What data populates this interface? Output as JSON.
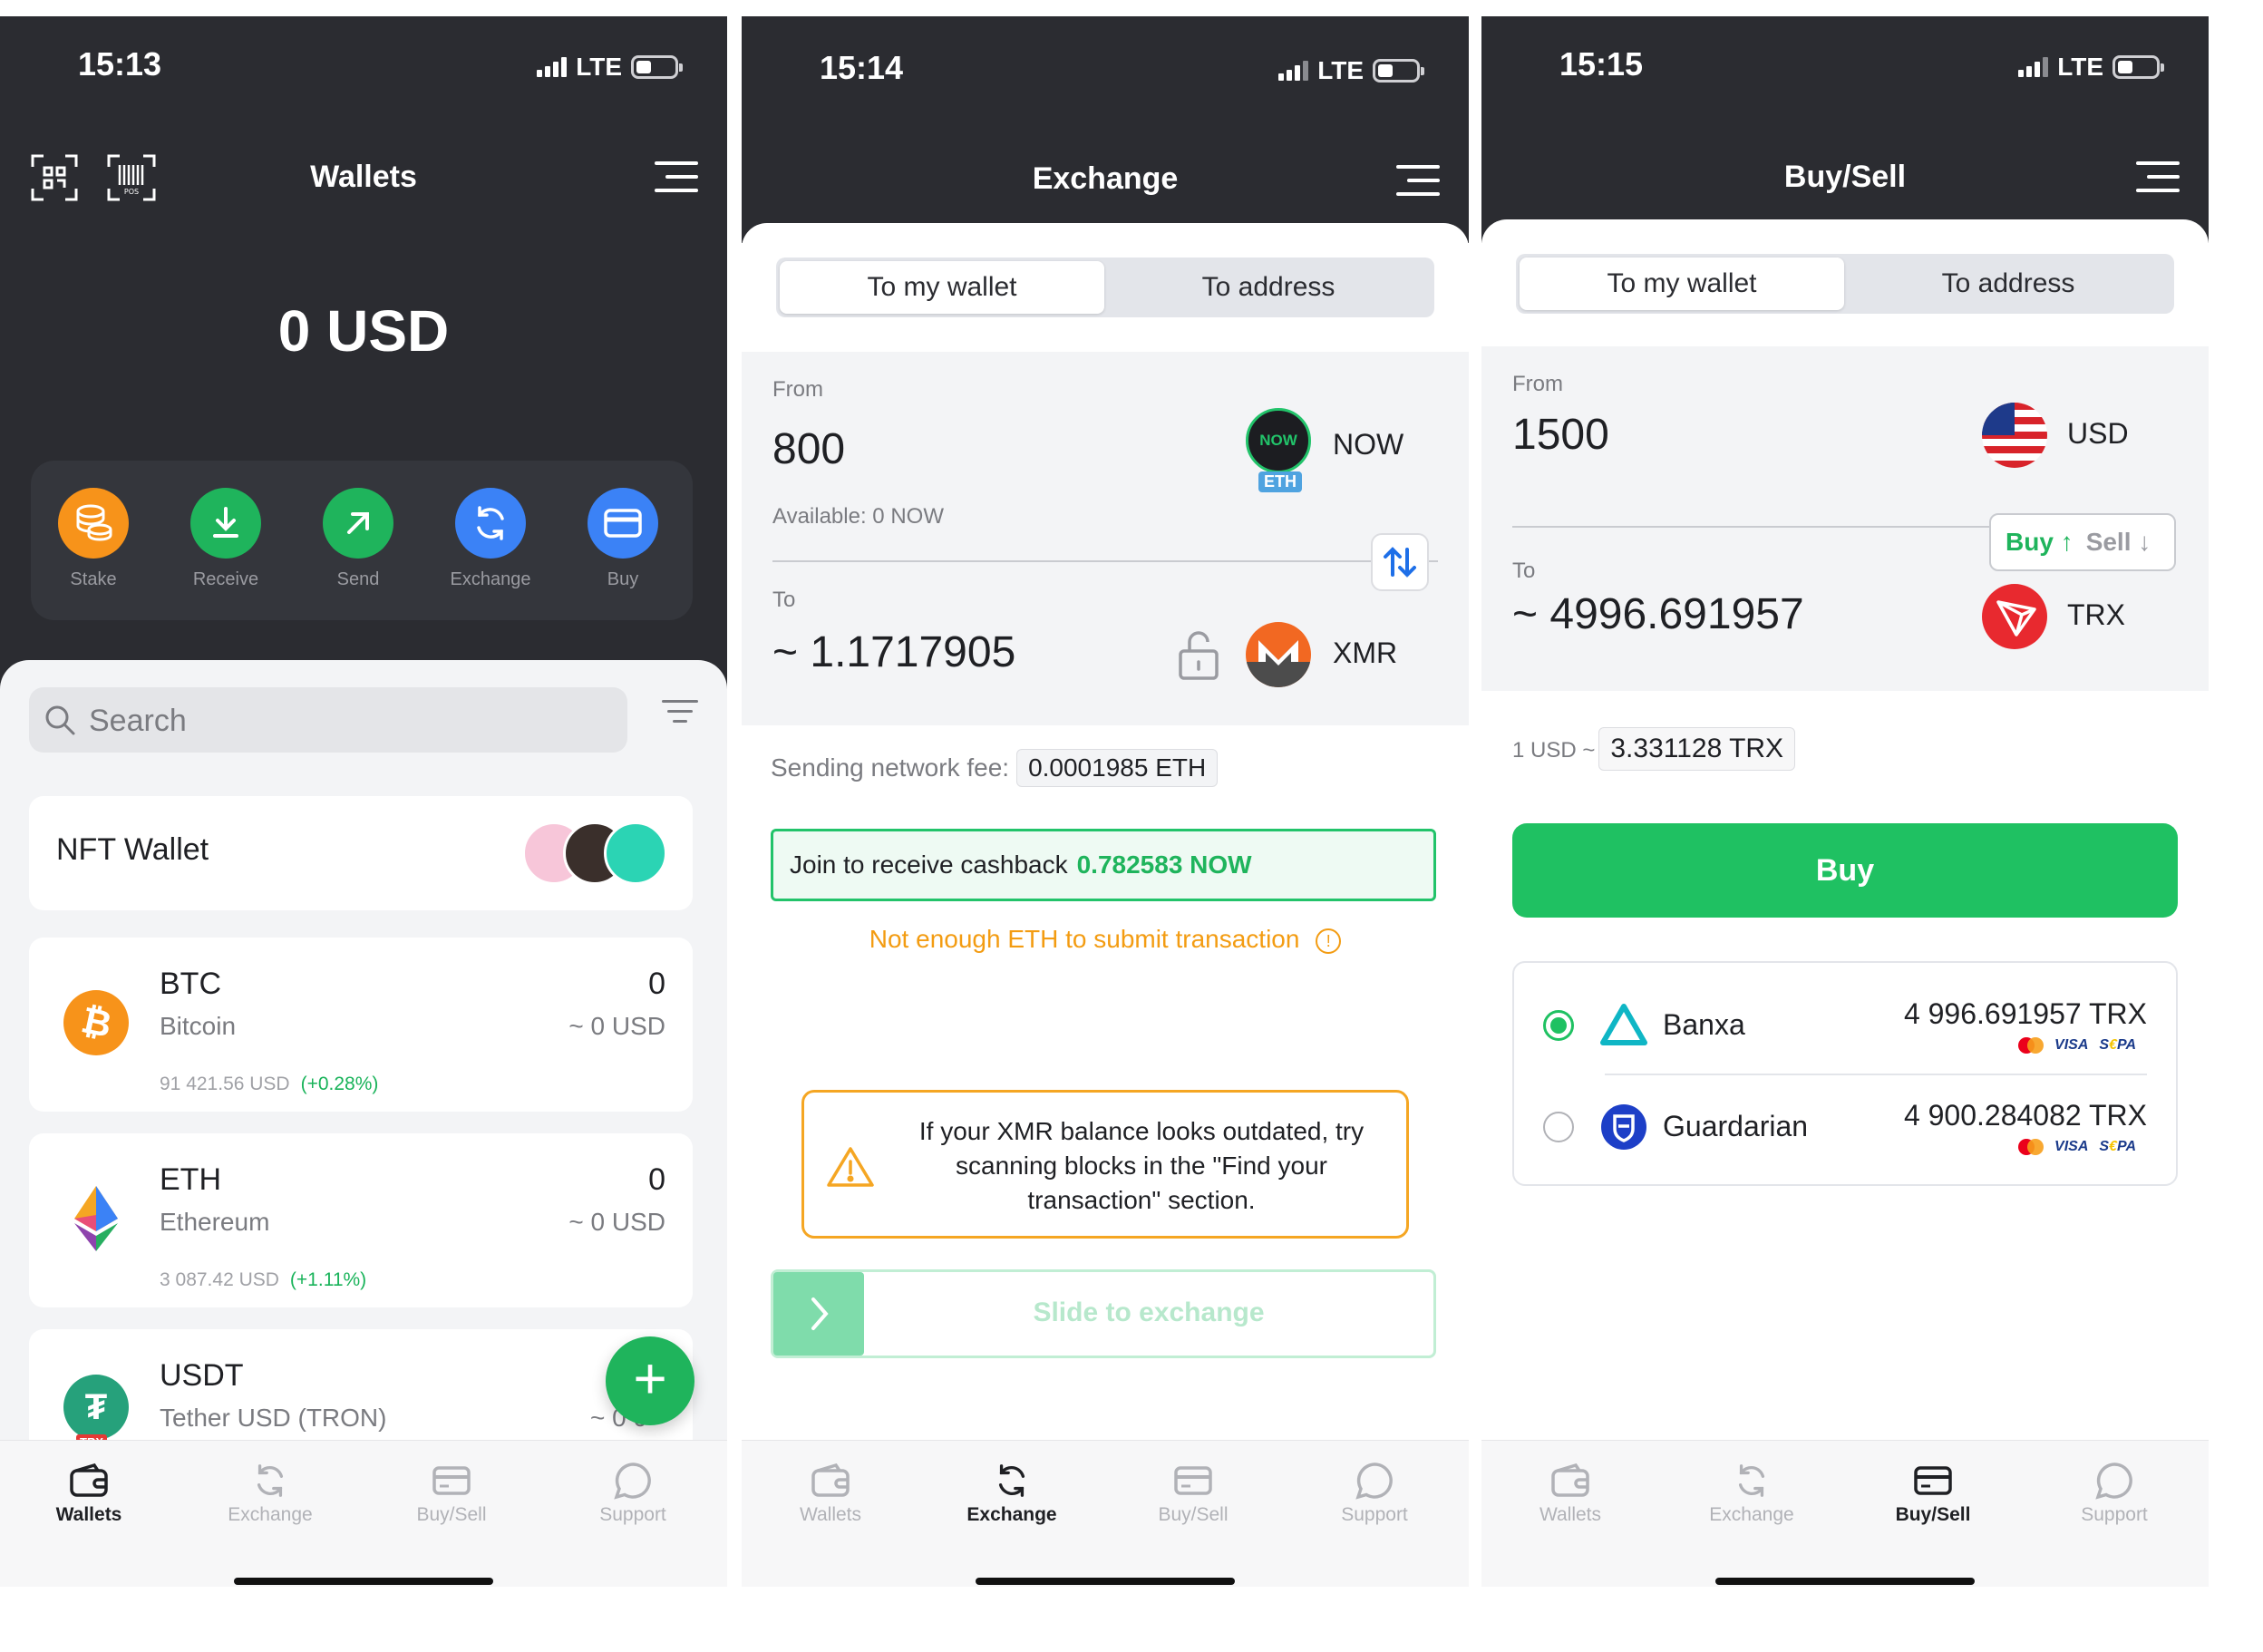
{
  "colors": {
    "dark": "#2b2c31",
    "green": "#1fc162",
    "orange": "#f39c12",
    "blue": "#3b82f6"
  },
  "screen1": {
    "time": "15:13",
    "network": "LTE",
    "title": "Wallets",
    "balance": "0 USD",
    "actions": [
      {
        "label": "Stake",
        "icon": "coins-icon",
        "color": "#f7931a"
      },
      {
        "label": "Receive",
        "icon": "download-icon",
        "color": "#1fb45c"
      },
      {
        "label": "Send",
        "icon": "arrow-up-right-icon",
        "color": "#1fb45c"
      },
      {
        "label": "Exchange",
        "icon": "refresh-icon",
        "color": "#3b82f6"
      },
      {
        "label": "Buy",
        "icon": "card-icon",
        "color": "#3b82f6"
      }
    ],
    "search_placeholder": "Search",
    "nft_wallet": "NFT Wallet",
    "coins": [
      {
        "symbol": "BTC",
        "name": "Bitcoin",
        "balance": "0",
        "usd": "~ 0 USD",
        "price": "91 421.56 USD",
        "change": "(+0.28%)"
      },
      {
        "symbol": "ETH",
        "name": "Ethereum",
        "balance": "0",
        "usd": "~ 0 USD",
        "price": "3 087.42 USD",
        "change": "(+1.11%)"
      },
      {
        "symbol": "USDT",
        "name": "Tether USD (TRON)",
        "balance": "",
        "usd": "~ 0 0",
        "badge": "TRX"
      }
    ],
    "fab": "+"
  },
  "screen2": {
    "time": "15:14",
    "network": "LTE",
    "title": "Exchange",
    "tabs": [
      "To my wallet",
      "To address"
    ],
    "from_label": "From",
    "from_amount": "800",
    "from_currency": "NOW",
    "from_badge": "ETH",
    "from_logo": "NOW",
    "available": "Available: 0 NOW",
    "to_label": "To",
    "to_amount": "~ 1.1717905",
    "to_currency": "XMR",
    "fee_label": "Sending network fee:",
    "fee_value": "0.0001985 ETH",
    "cashback_label": "Join to receive cashback",
    "cashback_value": "0.782583 NOW",
    "warning": "Not enough ETH to submit transaction",
    "notice": "If your XMR balance looks outdated, try scanning blocks in the \"Find your transaction\" section.",
    "slide": "Slide to exchange"
  },
  "screen3": {
    "time": "15:15",
    "network": "LTE",
    "title": "Buy/Sell",
    "tabs": [
      "To my wallet",
      "To address"
    ],
    "from_label": "From",
    "from_amount": "1500",
    "from_currency": "USD",
    "buy_toggle": "Buy ↑",
    "sell_toggle": "Sell ↓",
    "to_label": "To",
    "to_amount": "~ 4996.691957",
    "to_currency": "TRX",
    "rate_prefix": "1 USD ~",
    "rate_value": "3.331128 TRX",
    "buy_button": "Buy",
    "providers": [
      {
        "name": "Banxa",
        "value": "4 996.691957 TRX",
        "selected": true
      },
      {
        "name": "Guardarian",
        "value": "4 900.284082 TRX",
        "selected": false
      }
    ],
    "pay_methods": {
      "visa": "VISA",
      "sepa_prefix": "S",
      "sepa_highlight": "€",
      "sepa_suffix": "PA"
    }
  },
  "tabbar": [
    "Wallets",
    "Exchange",
    "Buy/Sell",
    "Support"
  ]
}
